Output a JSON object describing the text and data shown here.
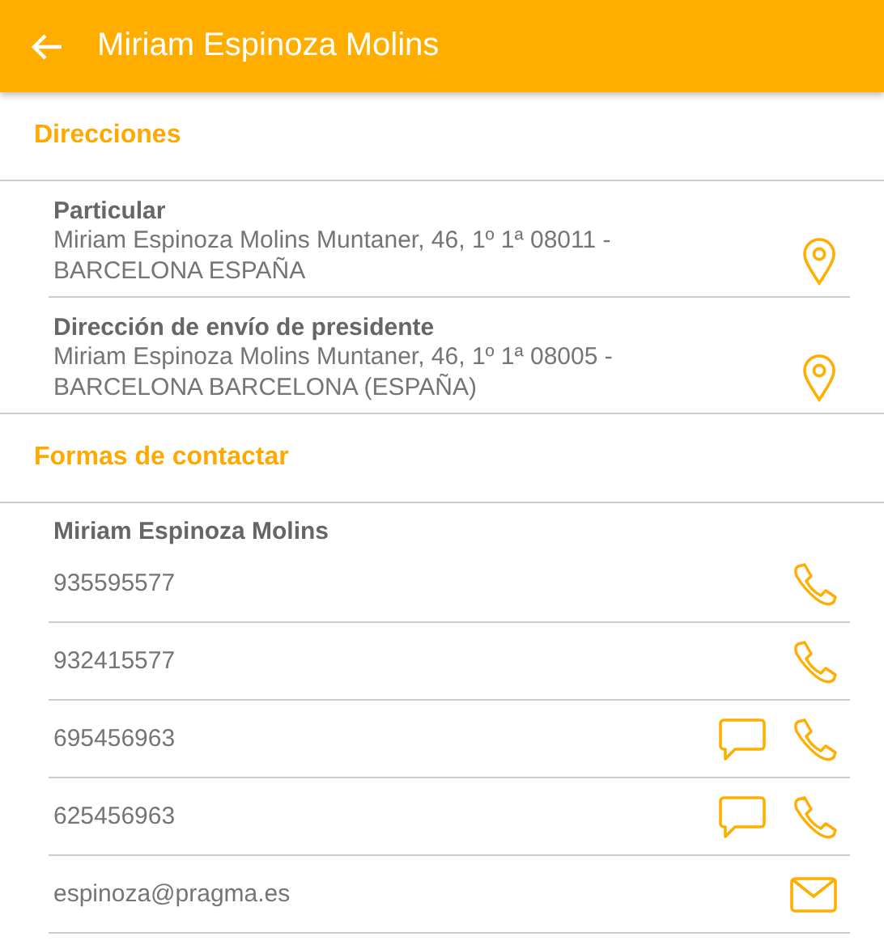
{
  "header": {
    "title": "Miriam Espinoza Molins"
  },
  "sections": [
    {
      "title": "Direcciones",
      "kind": "addresses",
      "items": [
        {
          "label": "Particular",
          "address": "Miriam Espinoza Molins Muntaner, 46, 1º 1ª 08011 - BARCELONA ESPAÑA"
        },
        {
          "label": "Dirección de envío de presidente",
          "address": "Miriam Espinoza Molins Muntaner, 46, 1º 1ª 08005 - BARCELONA BARCELONA (ESPAÑA)"
        }
      ]
    },
    {
      "title": "Formas de contactar",
      "kind": "contacts",
      "name": "Miriam Espinoza Molins",
      "items": [
        {
          "kind": "phone",
          "value": "935595577",
          "sms": false
        },
        {
          "kind": "phone",
          "value": "932415577",
          "sms": false
        },
        {
          "kind": "phone",
          "value": "695456963",
          "sms": true
        },
        {
          "kind": "phone",
          "value": "625456963",
          "sms": true
        },
        {
          "kind": "email",
          "value": "espinoza@pragma.es",
          "sms": false
        }
      ]
    }
  ]
}
